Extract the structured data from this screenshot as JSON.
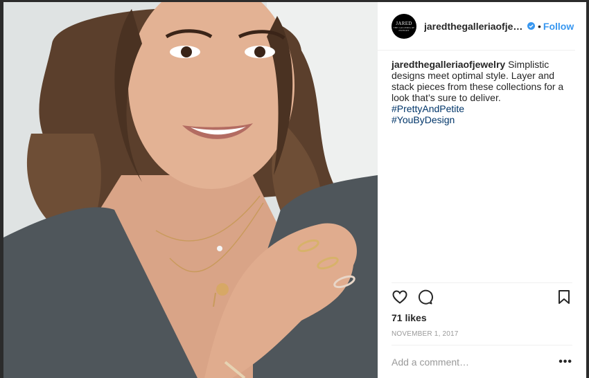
{
  "post": {
    "username": "jaredthegalleriaofjewelry",
    "username_display": "jaredthegalleriaofjew...",
    "avatar_text": "JARED",
    "avatar_subtext": "THE GALLERIA OF JEWELRY",
    "verified": true,
    "separator": "•",
    "follow_label": "Follow",
    "caption_user": "jaredthegalleriaofjewelry",
    "caption_text": " Simplistic designs meet optimal style. Layer and stack pieces from these collections for a look that’s sure to deliver. ",
    "hashtags": [
      "#PrettyAndPetite",
      "#YouByDesign"
    ],
    "likes": "71 likes",
    "date": "NOVEMBER 1, 2017",
    "comment_placeholder": "Add a comment…",
    "more_label": "•••"
  },
  "colors": {
    "link_blue": "#3897f0",
    "hashtag": "#003569",
    "text": "#262626",
    "muted": "#999999"
  },
  "icons": [
    "heart-icon",
    "comment-icon",
    "bookmark-icon",
    "verified-badge-icon"
  ]
}
